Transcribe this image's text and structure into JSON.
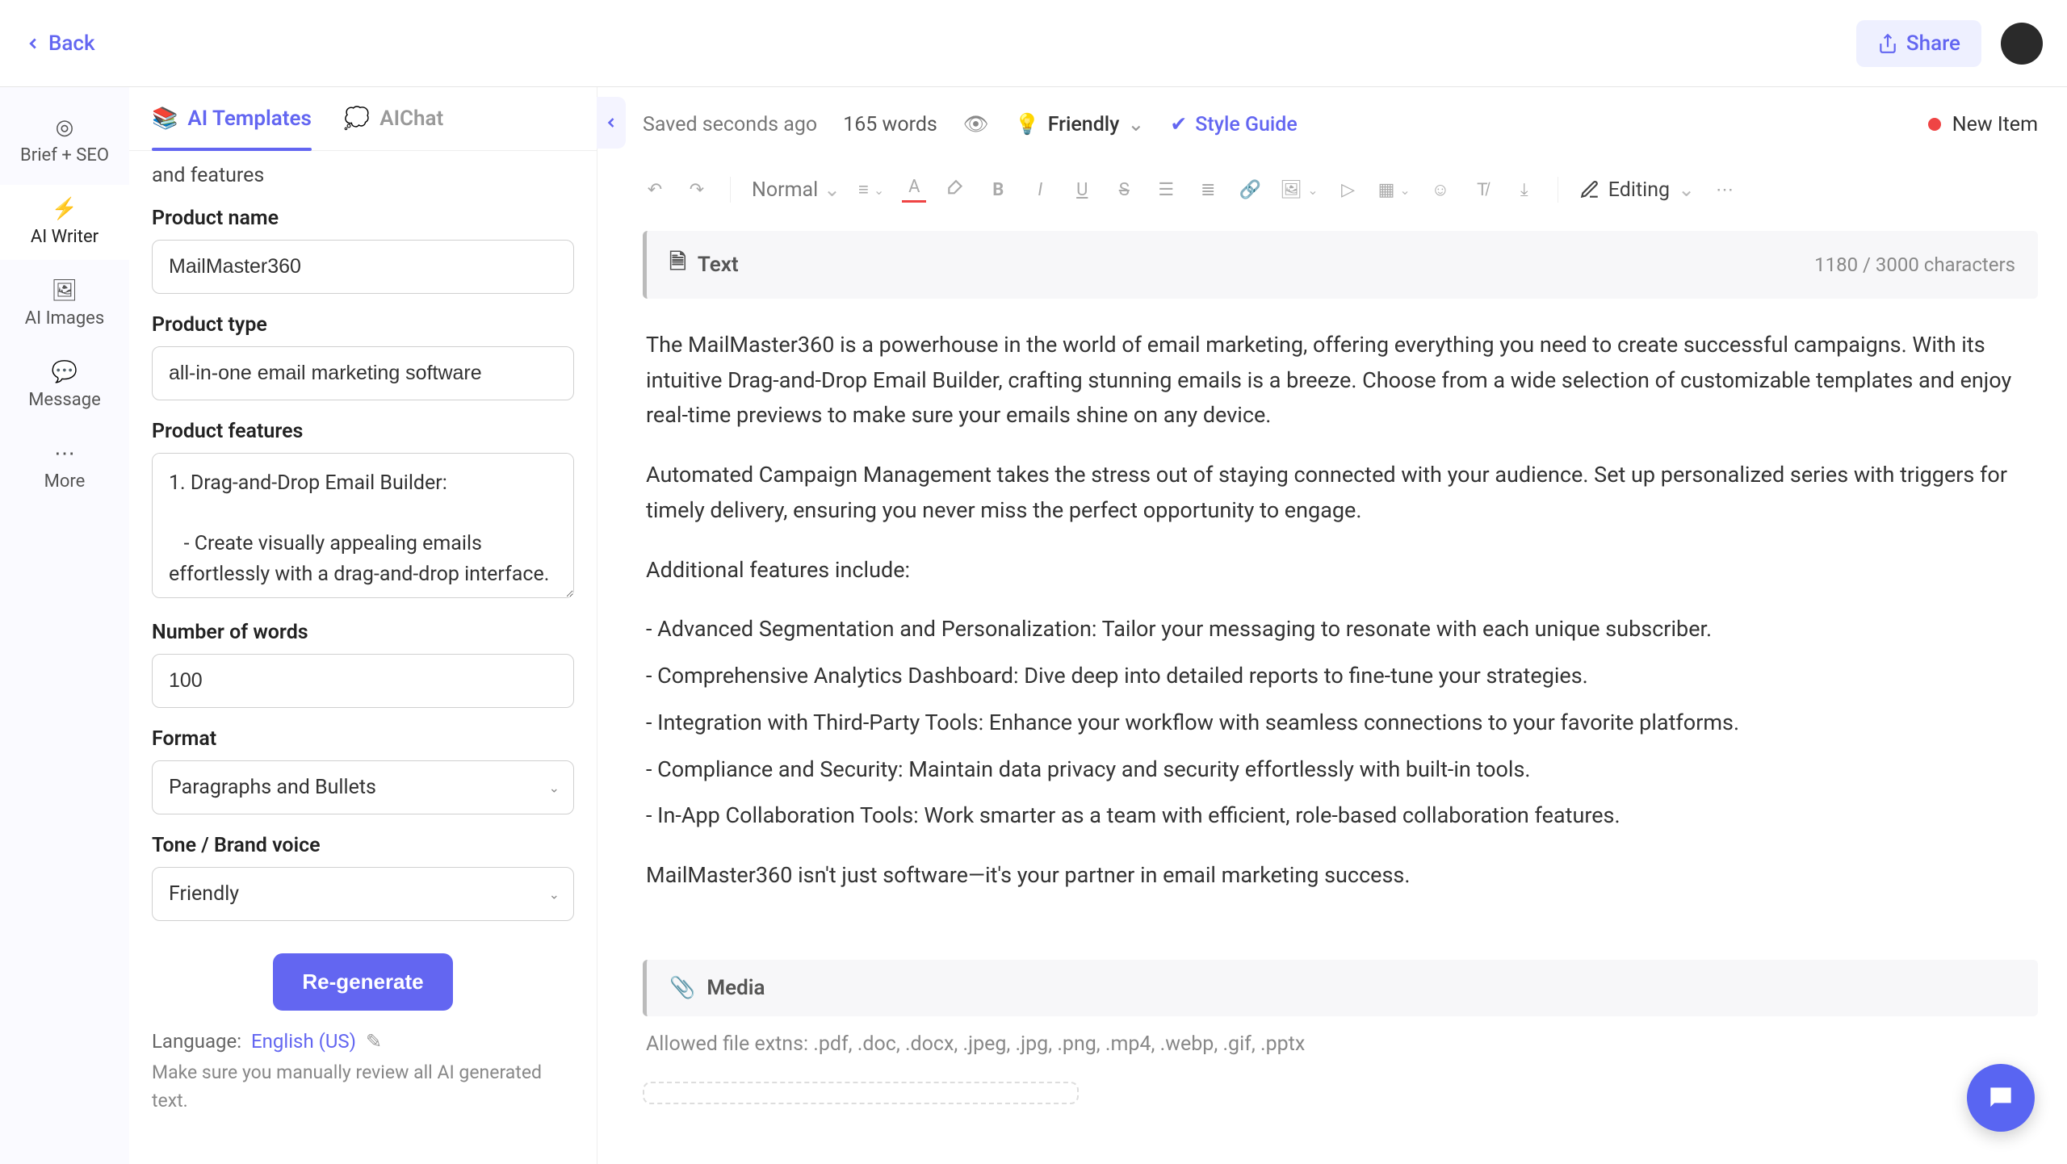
{
  "topbar": {
    "back": "Back",
    "share": "Share"
  },
  "rail": [
    {
      "label": "Brief + SEO"
    },
    {
      "label": "AI Writer"
    },
    {
      "label": "AI Images"
    },
    {
      "label": "Message"
    },
    {
      "label": "More"
    }
  ],
  "sidepanel": {
    "tabs": {
      "templates": "AI Templates",
      "chat": "AIChat"
    },
    "clip_text": "and features",
    "fields": {
      "product_name": {
        "label": "Product name",
        "value": "MailMaster360"
      },
      "product_type": {
        "label": "Product type",
        "value": "all-in-one email marketing software"
      },
      "product_features": {
        "label": "Product features",
        "value": "1. Drag-and-Drop Email Builder:\n\n   - Create visually appealing emails effortlessly with a drag-and-drop interface."
      },
      "num_words": {
        "label": "Number of words",
        "value": "100"
      },
      "format": {
        "label": "Format",
        "value": "Paragraphs and Bullets"
      },
      "tone": {
        "label": "Tone / Brand voice",
        "value": "Friendly"
      }
    },
    "regenerate": "Re-generate",
    "language_prefix": "Language:",
    "language_value": "English (US)",
    "note": "Make sure you manually review all AI generated text."
  },
  "editor": {
    "saved": "Saved seconds ago",
    "word_count": "165 words",
    "tone": "Friendly",
    "style_guide": "Style Guide",
    "status": "New Item",
    "toolbar": {
      "normal": "Normal",
      "editing": "Editing"
    },
    "text_card": {
      "title": "Text",
      "char_count": "1180 / 3000 characters",
      "p1": "The MailMaster360 is a powerhouse in the world of email marketing, offering everything you need to create successful campaigns. With its intuitive Drag-and-Drop Email Builder, crafting stunning emails is a breeze. Choose from a wide selection of customizable templates and enjoy real-time previews to make sure your emails shine on any device.",
      "p2": "Automated Campaign Management takes the stress out of staying connected with your audience. Set up personalized series with triggers for timely delivery, ensuring you never miss the perfect opportunity to engage.",
      "p3": "Additional features include:",
      "b1": "- Advanced Segmentation and Personalization: Tailor your messaging to resonate with each unique subscriber.",
      "b2": "- Comprehensive Analytics Dashboard: Dive deep into detailed reports to fine-tune your strategies.",
      "b3": "- Integration with Third-Party Tools: Enhance your workflow with seamless connections to your favorite platforms.",
      "b4": "- Compliance and Security: Maintain data privacy and security effortlessly with built-in tools.",
      "b5": "- In-App Collaboration Tools: Work smarter as a team with efficient, role-based collaboration features.",
      "p4": "MailMaster360 isn't just software—it's your partner in email marketing success."
    },
    "media_card": {
      "title": "Media",
      "note": "Allowed file extns: .pdf, .doc, .docx, .jpeg, .jpg, .png, .mp4, .webp, .gif, .pptx"
    }
  }
}
